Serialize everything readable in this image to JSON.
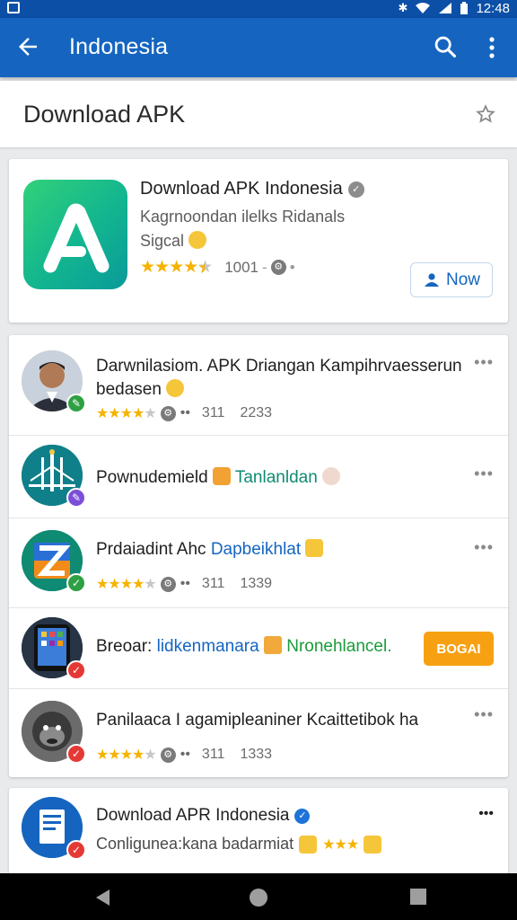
{
  "status_bar": {
    "time": "12:48"
  },
  "app_bar": {
    "title": "Indonesia",
    "back_icon": "arrow-left-icon",
    "search_icon": "search-icon",
    "more_icon": "more-vert-icon"
  },
  "header": {
    "title": "Download APK",
    "star_icon": "star-outline-icon"
  },
  "featured": {
    "title": "Download APK Indonesia",
    "subtitle_line1": "Kagrnoondan ilelks Ridanals",
    "subtitle_line2": "Sigcal",
    "rating_value": "1001",
    "button_label": "Now",
    "stars_filled": 4.5
  },
  "list": [
    {
      "title": "Darwnilasiom. APK Driangan Kampihrvaesserun bedasen",
      "meta1": "311",
      "meta2": "2233",
      "stars_filled": 4,
      "badge_color": "#2ea043",
      "avatar": "person-avatar",
      "action": "more"
    },
    {
      "title_main": "Pownudemield",
      "title_accent": "Tanlanldan",
      "badge_color": "#7b4fd8",
      "avatar": "bridge-avatar",
      "action": "more"
    },
    {
      "title_main": "Prdaiadint Ahc",
      "title_accent": "Dapbeikhlat",
      "meta1": "311",
      "meta2": "1339",
      "stars_filled": 4,
      "badge_color": "#2ea043",
      "avatar": "z-logo-avatar",
      "action": "more"
    },
    {
      "title_main": "Breoar:",
      "title_accent1": "lidkenmanara",
      "title_accent2": "Nronehlancel.",
      "button_label": "BOGAI",
      "badge_color": "#e53935",
      "avatar": "phone-avatar",
      "action": "button"
    },
    {
      "title": "Panilaaca I agamipleaniner Kcaittetibok ha",
      "meta1": "311",
      "meta2": "1333",
      "stars_filled": 4,
      "badge_color": "#e53935",
      "avatar": "gorilla-avatar",
      "action": "more"
    }
  ],
  "bottom_item": {
    "title": "Download APR Indonesia",
    "subtitle": "Conligunea:kana badarmiat",
    "badge_color": "#e53935",
    "avatar": "document-avatar"
  },
  "nav_bar": {
    "back_icon": "nav-back-icon",
    "home_icon": "nav-home-icon",
    "recents_icon": "nav-recents-icon"
  },
  "colors": {
    "primary": "#1565c0",
    "status_bar": "#0b4fa6",
    "star": "#f5b300",
    "accent_orange": "#f7a112"
  }
}
